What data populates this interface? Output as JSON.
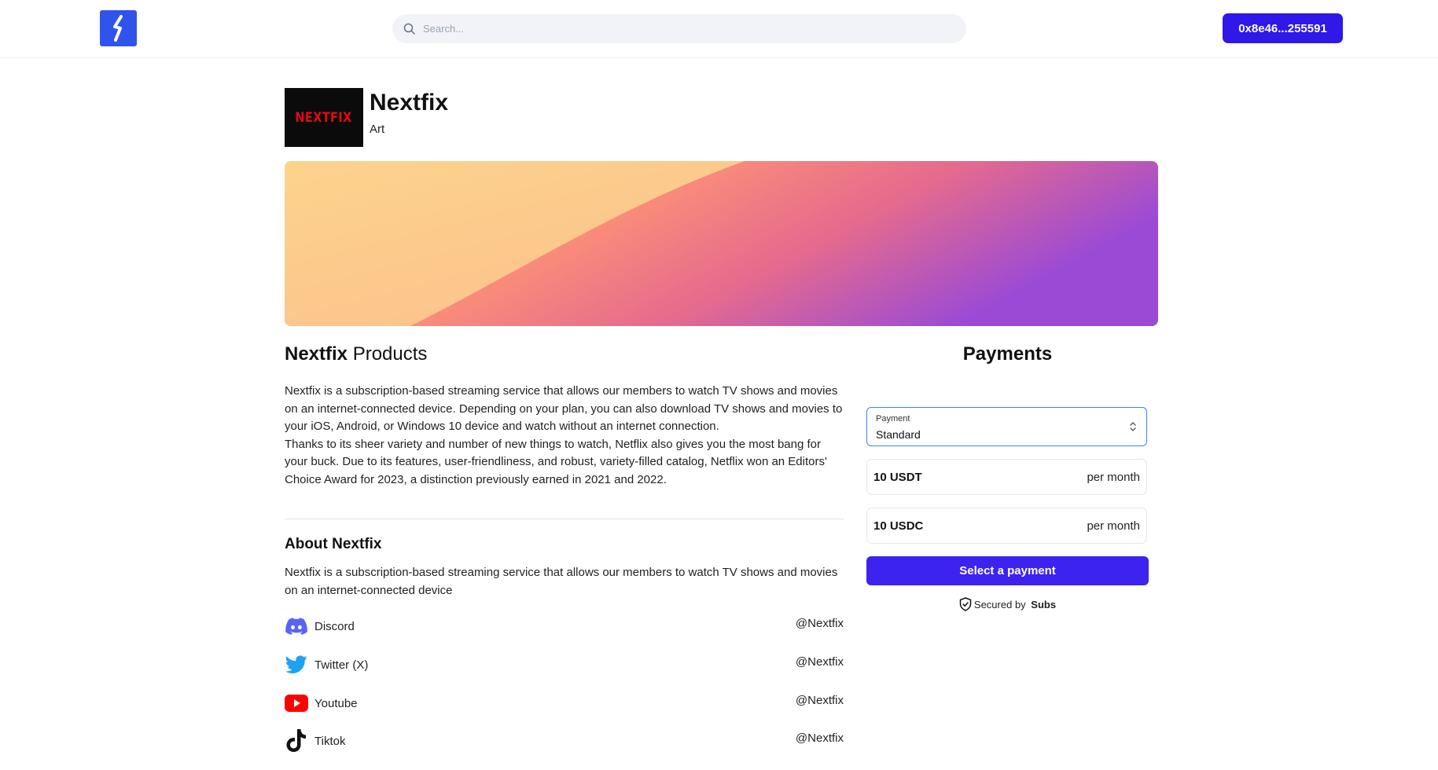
{
  "header": {
    "logo_icon": "bolt-icon",
    "search_placeholder": "Search...",
    "wallet_label": "0x8e46...255591",
    "accent": "#2f18e8"
  },
  "brand": {
    "logo_text": "NEXTFIX",
    "name": "Nextfix",
    "category": "Art"
  },
  "products": {
    "title_bold": "Nextfix",
    "title_rest": " Products",
    "paragraph1": "Nextfix is a subscription-based streaming service that allows our members to watch TV shows and movies on an internet-connected device. Depending on your plan, you can also download TV shows and movies to your iOS, Android, or Windows 10 device and watch without an internet connection.",
    "paragraph2": "Thanks to its sheer variety and number of new things to watch, Netflix also gives you the most bang for your buck. Due to its features, user-friendliness, and robust, variety-filled catalog, Netflix won an Editors' Choice Award for 2023, a distinction previously earned in 2021 and 2022."
  },
  "about": {
    "title": "About Nextfix",
    "text": "Nextfix is a subscription-based streaming service that allows our members to watch TV shows and movies on an internet-connected device",
    "socials": [
      {
        "icon": "discord-icon",
        "name": "Discord",
        "handle": "@Nextfix"
      },
      {
        "icon": "twitter-icon",
        "name": "Twitter (X)",
        "handle": "@Nextfix"
      },
      {
        "icon": "youtube-icon",
        "name": "Youtube",
        "handle": "@Nextfix"
      },
      {
        "icon": "tiktok-icon",
        "name": "Tiktok",
        "handle": "@Nextfix"
      }
    ]
  },
  "payments": {
    "title": "Payments",
    "select_label": "Payment",
    "select_value": "Standard",
    "options": [
      {
        "amount": "10 USDT",
        "period": "per month"
      },
      {
        "amount": "10 USDC",
        "period": "per month"
      }
    ],
    "button_label": "Select a payment",
    "secured_prefix": "Secured by ",
    "secured_brand": "Subs"
  }
}
